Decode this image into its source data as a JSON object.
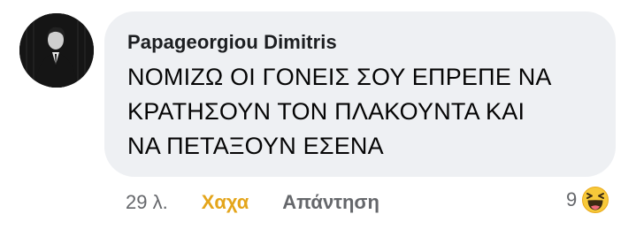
{
  "comment": {
    "author": "Papageorgiou Dimitris",
    "text_lines": [
      "ΝΟΜΙΖΩ ΟΙ ΓΟΝΕΙΣ ΣΟΥ ΕΠΡΕΠΕ ΝΑ",
      "ΚΡΑΤΗΣΟΥΝ ΤΟΝ ΠΛΑΚΟΥΝΤΑ ΚΑΙ",
      "ΝΑ ΠΕΤΑΞΟΥΝ ΕΣΕΝΑ"
    ]
  },
  "actions": {
    "time": "29 λ.",
    "reaction_label": "Χαχα",
    "reply_label": "Απάντηση"
  },
  "reactions": {
    "count": "9",
    "icon": "haha-emoji-icon",
    "reaction_color": "#e4a51b"
  },
  "colors": {
    "bubble": "#eef0f3",
    "secondary_text": "#65676b"
  }
}
